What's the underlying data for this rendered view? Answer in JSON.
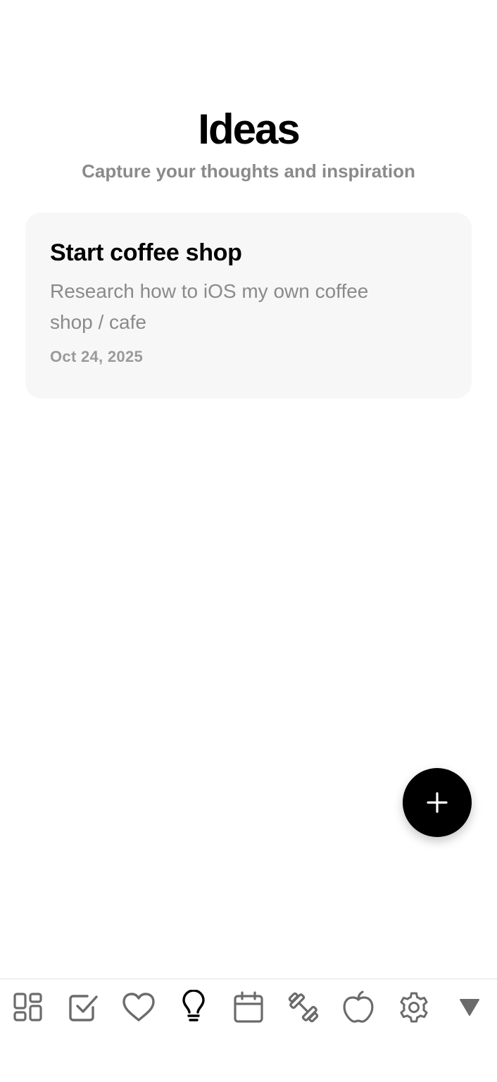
{
  "header": {
    "title": "Ideas",
    "subtitle": "Capture your thoughts and inspiration"
  },
  "ideas": [
    {
      "title": "Start coffee shop",
      "description": "Research how to iOS my own coffee shop / cafe",
      "date": "Oct 24, 2025"
    }
  ],
  "fab": {
    "icon": "plus-icon"
  },
  "tabbar": {
    "items": [
      {
        "icon": "dashboard-icon",
        "active": false
      },
      {
        "icon": "checkbox-icon",
        "active": false
      },
      {
        "icon": "heart-icon",
        "active": false
      },
      {
        "icon": "lightbulb-icon",
        "active": true
      },
      {
        "icon": "calendar-icon",
        "active": false
      },
      {
        "icon": "dumbbell-icon",
        "active": false
      },
      {
        "icon": "apple-icon",
        "active": false
      },
      {
        "icon": "gear-icon",
        "active": false
      },
      {
        "icon": "triangle-down-icon",
        "active": false
      }
    ],
    "colors": {
      "inactive": "#6b6b6b",
      "active": "#000000"
    }
  },
  "colors": {
    "background": "#ffffff",
    "card": "#f7f7f7",
    "muted_text": "#8a8a8a",
    "fab": "#000000"
  }
}
